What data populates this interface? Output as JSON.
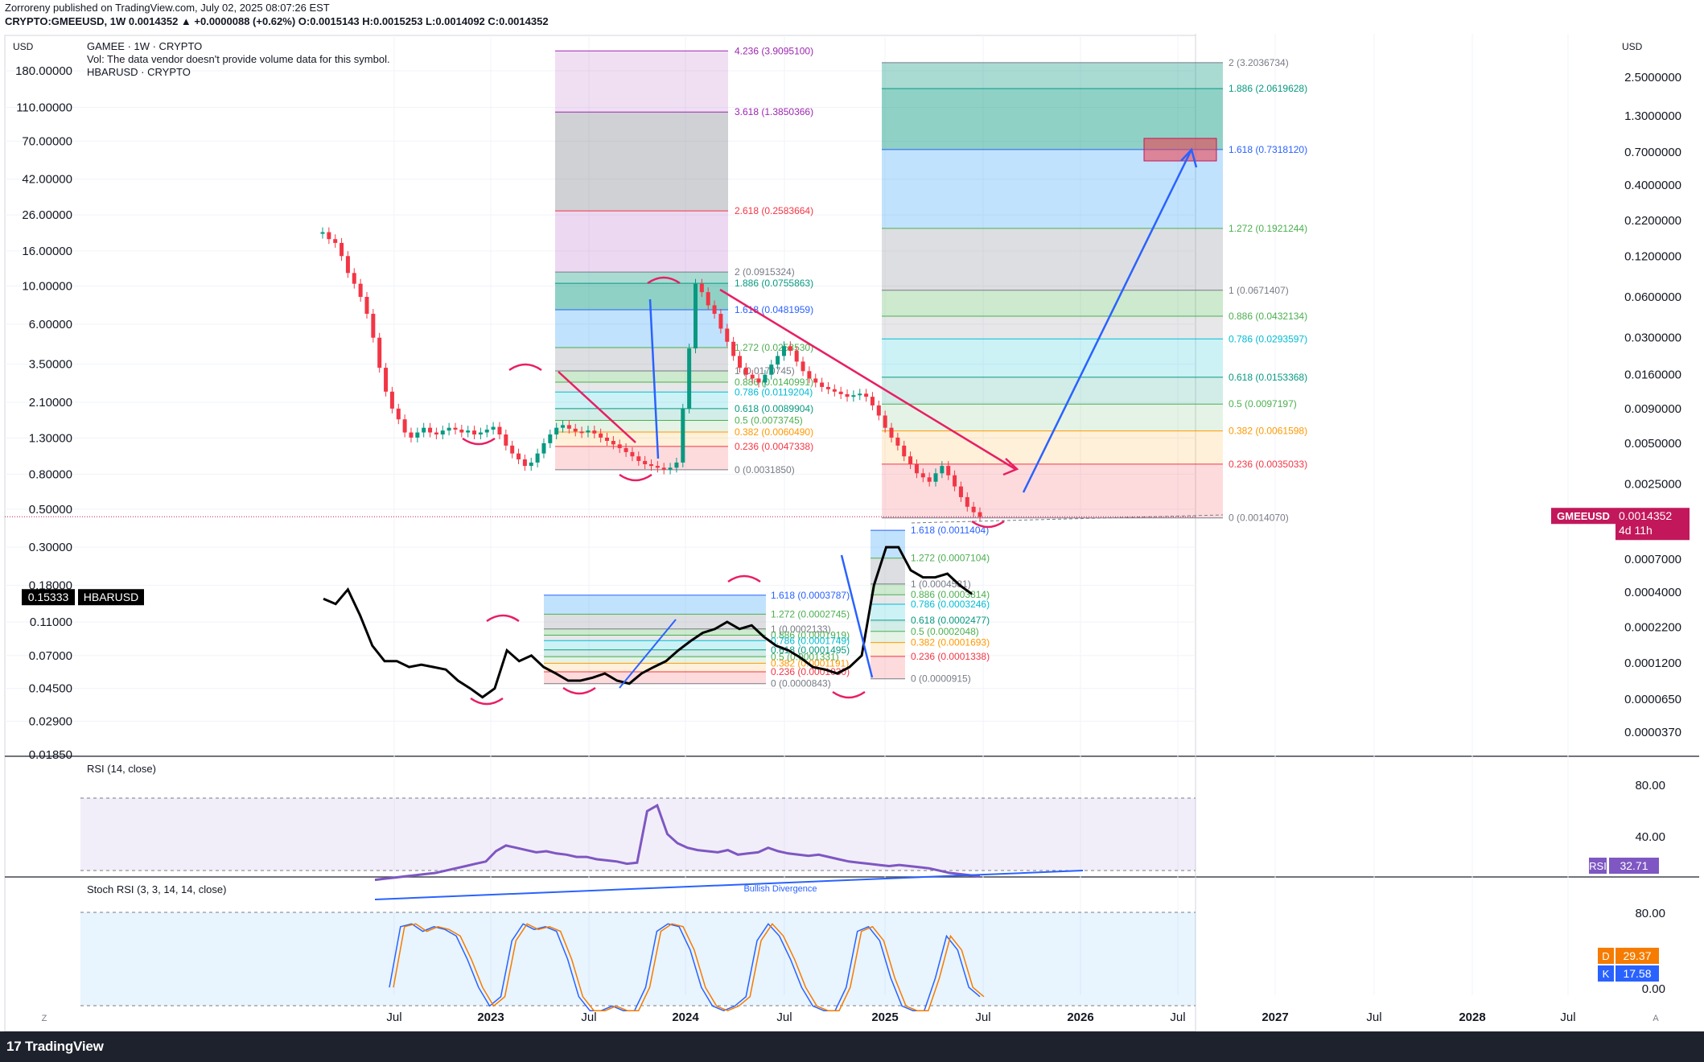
{
  "header": {
    "publisher": "Zorroreny published on TradingView.com, July 02, 2025 08:07:26 EST",
    "symbol_line": "CRYPTO:GMEEUSD, 1W 0.0014352 ▲ +0.0000088 (+0.62%) O:0.0015143 H:0.0015253 L:0.0014092 C:0.0014352"
  },
  "footer": {
    "brand": "TradingView",
    "logo_mark": "17"
  },
  "chart_data": {
    "type": "line",
    "title": "GAMEE · 1W · CRYPTO",
    "legend_lines": [
      "GAMEE · 1W · CRYPTO",
      "Vol: The data vendor doesn't provide volume data for this symbol.",
      "HBARUSD · CRYPTO"
    ],
    "currency_left": "USD",
    "currency_right": "USD",
    "scale": "log",
    "x_ticks": [
      "Jul",
      "2023",
      "Jul",
      "2024",
      "Jul",
      "2025",
      "Jul",
      "2026",
      "Jul",
      "2027",
      "Jul",
      "2028",
      "Jul"
    ],
    "left_axis_ticks": [
      "180.00000",
      "110.00000",
      "70.00000",
      "42.00000",
      "26.00000",
      "16.00000",
      "10.00000",
      "6.00000",
      "3.50000",
      "2.10000",
      "1.30000",
      "0.80000",
      "0.50000",
      "0.30000",
      "0.18000",
      "0.11000",
      "0.07000",
      "0.04500",
      "0.02900",
      "0.01850"
    ],
    "right_axis_ticks": [
      "2.5000000",
      "1.3000000",
      "0.7000000",
      "0.4000000",
      "0.2200000",
      "0.1200000",
      "0.0600000",
      "0.0300000",
      "0.0160000",
      "0.0090000",
      "0.0050000",
      "0.0025000",
      "0.0007000",
      "0.0004000",
      "0.0002200",
      "0.0001200",
      "0.0000650",
      "0.0000370"
    ],
    "last_price": {
      "symbol": "GMEEUSD",
      "value": "0.0014352",
      "countdown": "4d 11h",
      "color": "#c2185b"
    },
    "hbar_label": {
      "value": "0.15333",
      "symbol": "HBARUSD"
    },
    "series": [
      {
        "name": "GMEEUSD",
        "style": "candles",
        "y_start": 0.18,
        "y_end": 0.00143,
        "candles_close": [
          0.18,
          0.16,
          0.15,
          0.12,
          0.09,
          0.075,
          0.06,
          0.045,
          0.03,
          0.018,
          0.012,
          0.009,
          0.0075,
          0.006,
          0.0055,
          0.006,
          0.0065,
          0.006,
          0.0058,
          0.0062,
          0.0065,
          0.0063,
          0.006,
          0.0062,
          0.0058,
          0.006,
          0.0063,
          0.0066,
          0.0058,
          0.0048,
          0.0042,
          0.0038,
          0.0034,
          0.0036,
          0.0042,
          0.005,
          0.0058,
          0.0065,
          0.0068,
          0.0064,
          0.0061,
          0.006,
          0.0062,
          0.0059,
          0.0055,
          0.0052,
          0.0049,
          0.0046,
          0.0043,
          0.004,
          0.0037,
          0.0035,
          0.0034,
          0.0033,
          0.0032,
          0.0033,
          0.0036,
          0.009,
          0.025,
          0.075,
          0.065,
          0.052,
          0.045,
          0.035,
          0.028,
          0.022,
          0.018,
          0.016,
          0.015,
          0.014,
          0.016,
          0.019,
          0.022,
          0.026,
          0.024,
          0.02,
          0.017,
          0.015,
          0.014,
          0.013,
          0.0125,
          0.012,
          0.0115,
          0.011,
          0.0113,
          0.0116,
          0.011,
          0.0095,
          0.008,
          0.0065,
          0.0055,
          0.0048,
          0.004,
          0.0035,
          0.003,
          0.0028,
          0.0026,
          0.003,
          0.0034,
          0.0029,
          0.0024,
          0.002,
          0.0017,
          0.00155,
          0.00143
        ]
      },
      {
        "name": "HBARUSD",
        "style": "line",
        "color": "#000000",
        "values_approx": [
          0.15,
          0.14,
          0.17,
          0.12,
          0.08,
          0.065,
          0.065,
          0.06,
          0.062,
          0.06,
          0.058,
          0.05,
          0.045,
          0.04,
          0.045,
          0.075,
          0.065,
          0.07,
          0.06,
          0.055,
          0.05,
          0.05,
          0.052,
          0.055,
          0.05,
          0.048,
          0.055,
          0.06,
          0.065,
          0.075,
          0.085,
          0.095,
          0.1,
          0.11,
          0.1,
          0.105,
          0.09,
          0.08,
          0.075,
          0.068,
          0.06,
          0.058,
          0.055,
          0.06,
          0.07,
          0.18,
          0.3,
          0.3,
          0.22,
          0.2,
          0.2,
          0.21,
          0.18,
          0.16
        ]
      }
    ],
    "fib_sets": [
      {
        "levels": [
          [
            "4.236",
            "3.9095100"
          ],
          [
            "3.618",
            "1.3850366"
          ],
          [
            "2.618",
            "0.2583664"
          ],
          [
            "2",
            "0.0915324"
          ],
          [
            "1.886",
            "0.0755863"
          ],
          [
            "1.618",
            "0.0481959"
          ],
          [
            "1.272",
            "0.0253530"
          ],
          [
            "1",
            "0.0170745"
          ],
          [
            "0.886",
            "0.0140991"
          ],
          [
            "0.786",
            "0.0119204"
          ],
          [
            "0.618",
            "0.0089904"
          ],
          [
            "0.5",
            "0.0073745"
          ],
          [
            "0.382",
            "0.0060490"
          ],
          [
            "0.236",
            "0.0047338"
          ],
          [
            "0",
            "0.0031850"
          ]
        ]
      },
      {
        "levels": [
          [
            "2",
            "3.2036734"
          ],
          [
            "1.886",
            "2.0619628"
          ],
          [
            "1.618",
            "0.7318120"
          ],
          [
            "1.272",
            "0.1921244"
          ],
          [
            "1",
            "0.0671407"
          ],
          [
            "0.886",
            "0.0432134"
          ],
          [
            "0.786",
            "0.0293597"
          ],
          [
            "0.618",
            "0.0153368"
          ],
          [
            "0.5",
            "0.0097197"
          ],
          [
            "0.382",
            "0.0061598"
          ],
          [
            "0.236",
            "0.0035033"
          ],
          [
            "0",
            "0.0014070"
          ]
        ]
      },
      {
        "levels": [
          [
            "1.618",
            "0.0003787"
          ],
          [
            "1.272",
            "0.0002745"
          ],
          [
            "1",
            "0.0002133"
          ],
          [
            "0.886",
            "0.0001919"
          ],
          [
            "0.786",
            "0.0001749"
          ],
          [
            "0.618",
            "0.0001495"
          ],
          [
            "0.5",
            "0.0001331"
          ],
          [
            "0.382",
            "0.0001191"
          ],
          [
            "0.236",
            "0.0001030"
          ],
          [
            "0",
            "0.0000843"
          ]
        ]
      },
      {
        "levels": [
          [
            "1.618",
            "0.0011404"
          ],
          [
            "1.272",
            "0.0007104"
          ],
          [
            "1",
            "0.0004581"
          ],
          [
            "0.886",
            "0.0003814"
          ],
          [
            "0.786",
            "0.0003246"
          ],
          [
            "0.618",
            "0.0002477"
          ],
          [
            "0.5",
            "0.0002048"
          ],
          [
            "0.382",
            "0.0001693"
          ],
          [
            "0.236",
            "0.0001338"
          ],
          [
            "0",
            "0.0000915"
          ]
        ]
      }
    ],
    "rsi": {
      "title": "RSI (14, close)",
      "ticks": [
        "80.00",
        "40.00"
      ],
      "value": "32.71",
      "label": "RSI",
      "annotation": "Bullish Divergence",
      "color": "#7e57c2"
    },
    "stoch_rsi": {
      "title": "Stoch RSI (3, 3, 14, 14, close)",
      "ticks": [
        "80.00",
        "0.00"
      ],
      "d_value": "29.37",
      "k_value": "17.58",
      "d_label": "D",
      "k_label": "K",
      "d_color": "#f57c00",
      "k_color": "#2962ff"
    },
    "corner_left": "Z",
    "corner_right": "A"
  }
}
